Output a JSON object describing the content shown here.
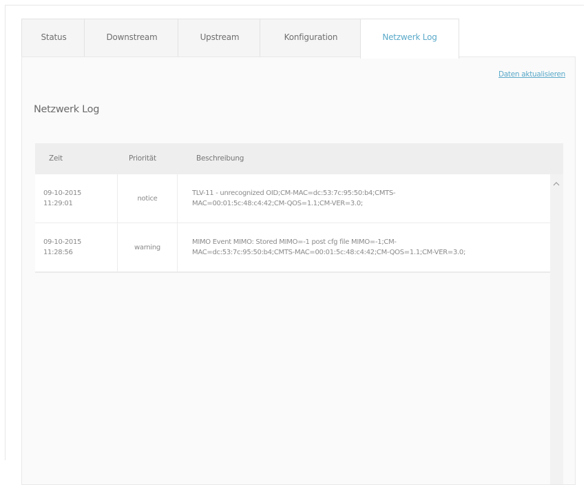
{
  "tabs": [
    {
      "label": "Status",
      "active": false
    },
    {
      "label": "Downstream",
      "active": false
    },
    {
      "label": "Upstream",
      "active": false
    },
    {
      "label": "Konfiguration",
      "active": false
    },
    {
      "label": "Netzwerk Log",
      "active": true
    }
  ],
  "refresh_link": "Daten aktualisieren",
  "section_title": "Netzwerk Log",
  "table": {
    "headers": {
      "time": "Zeit",
      "priority": "Priorität",
      "description": "Beschreibung"
    },
    "rows": [
      {
        "date": "09-10-2015",
        "time": "11:29:01",
        "priority": "notice",
        "desc_line1": "TLV-11 - unrecognized OID;CM-MAC=dc:53:7c:95:50:b4;CMTS-",
        "desc_line2": "MAC=00:01:5c:48:c4:42;CM-QOS=1.1;CM-VER=3.0;"
      },
      {
        "date": "09-10-2015",
        "time": "11:28:56",
        "priority": "warning",
        "desc_line1": "MIMO Event MIMO: Stored MIMO=-1 post cfg file MIMO=-1;CM-",
        "desc_line2": "MAC=dc:53:7c:95:50:b4;CMTS-MAC=00:01:5c:48:c4:42;CM-QOS=1.1;CM-VER=3.0;"
      }
    ]
  },
  "colors": {
    "accent": "#5aa9c9"
  },
  "icons": {
    "scroll_up": "chevron-up-icon"
  }
}
